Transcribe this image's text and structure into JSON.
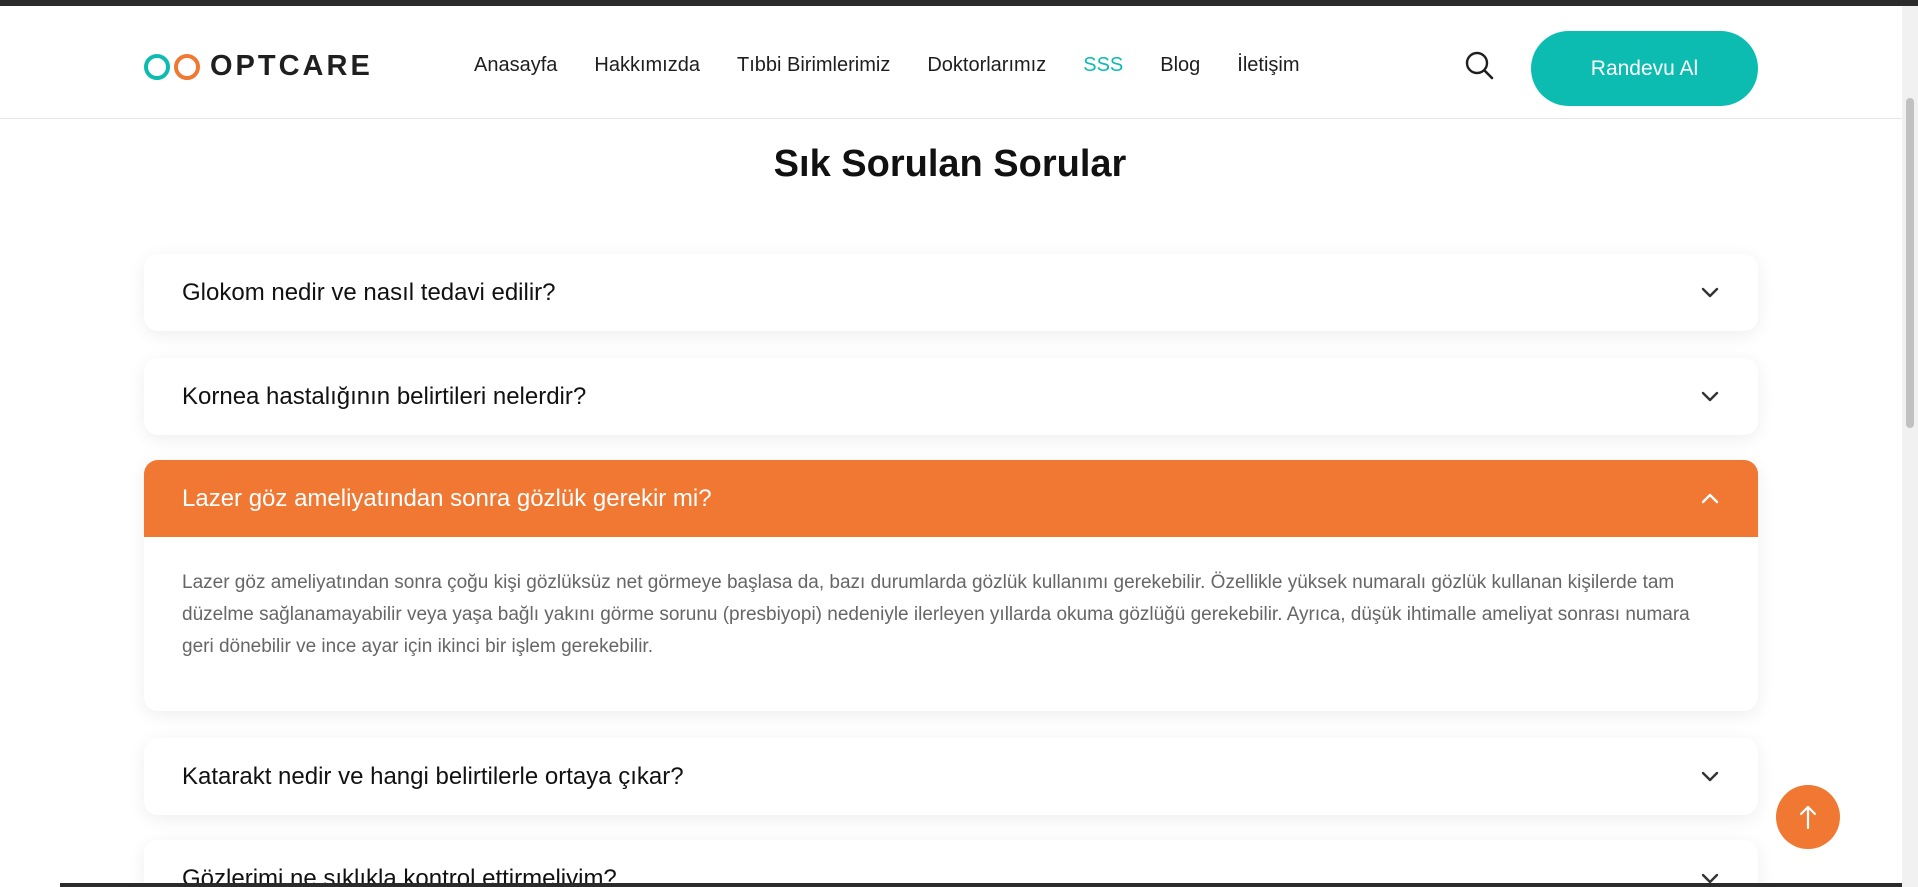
{
  "brand": {
    "name": "OPTCARE",
    "teal": "#0cbcb1",
    "orange": "#f07833"
  },
  "nav": {
    "items": [
      "Anasayfa",
      "Hakkımızda",
      "Tıbbi Birimlerimiz",
      "Doktorlarımız",
      "SSS",
      "Blog",
      "İletişim"
    ],
    "active": "SSS"
  },
  "header": {
    "search_icon": "search-icon",
    "cta_label": "Randevu Al"
  },
  "page": {
    "title": "Sık Sorulan Sorular"
  },
  "faq": [
    {
      "question": "Glokom nedir ve nasıl tedavi edilir?",
      "open": false
    },
    {
      "question": "Kornea hastalığının belirtileri nelerdir?",
      "open": false
    },
    {
      "question": "Lazer göz ameliyatından sonra gözlük gerekir mi?",
      "open": true,
      "answer": "Lazer göz ameliyatından sonra çoğu kişi gözlüksüz net görmeye başlasa da, bazı durumlarda gözlük kullanımı gerekebilir. Özellikle yüksek numaralı gözlük kullanan kişilerde tam düzelme sağlanamayabilir veya yaşa bağlı yakını görme sorunu (presbiyopi) nedeniyle ilerleyen yıllarda okuma gözlüğü gerekebilir. Ayrıca, düşük ihtimalle ameliyat sonrası numara geri dönebilir ve ince ayar için ikinci bir işlem gerekebilir."
    },
    {
      "question": "Katarakt nedir ve hangi belirtilerle ortaya çıkar?",
      "open": false
    },
    {
      "question": "Gözlerimi ne sıklıkla kontrol ettirmeliyim?",
      "open": false
    }
  ],
  "scroll_top_icon": "arrow-up-icon"
}
